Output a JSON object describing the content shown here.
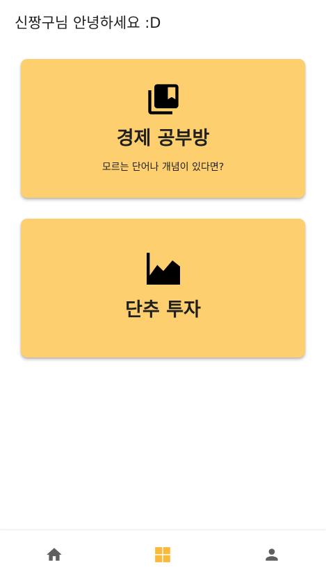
{
  "header": {
    "greeting": "신짱구님 안녕하세요 :D"
  },
  "cards": [
    {
      "title": "경제 공부방",
      "subtitle": "모르는 단어나 개념이 있다면?",
      "icon": "library-books-icon"
    },
    {
      "title": "단추 투자",
      "icon": "area-chart-icon"
    }
  ],
  "bottom_nav": {
    "items": [
      {
        "icon": "home-icon",
        "active": false
      },
      {
        "icon": "dashboard-icon",
        "active": true
      },
      {
        "icon": "person-icon",
        "active": false
      }
    ]
  },
  "colors": {
    "card_background": "#fdcf6f",
    "nav_active": "#f9b93a",
    "nav_inactive": "#5f5f5f",
    "text": "#1f1f1f"
  }
}
